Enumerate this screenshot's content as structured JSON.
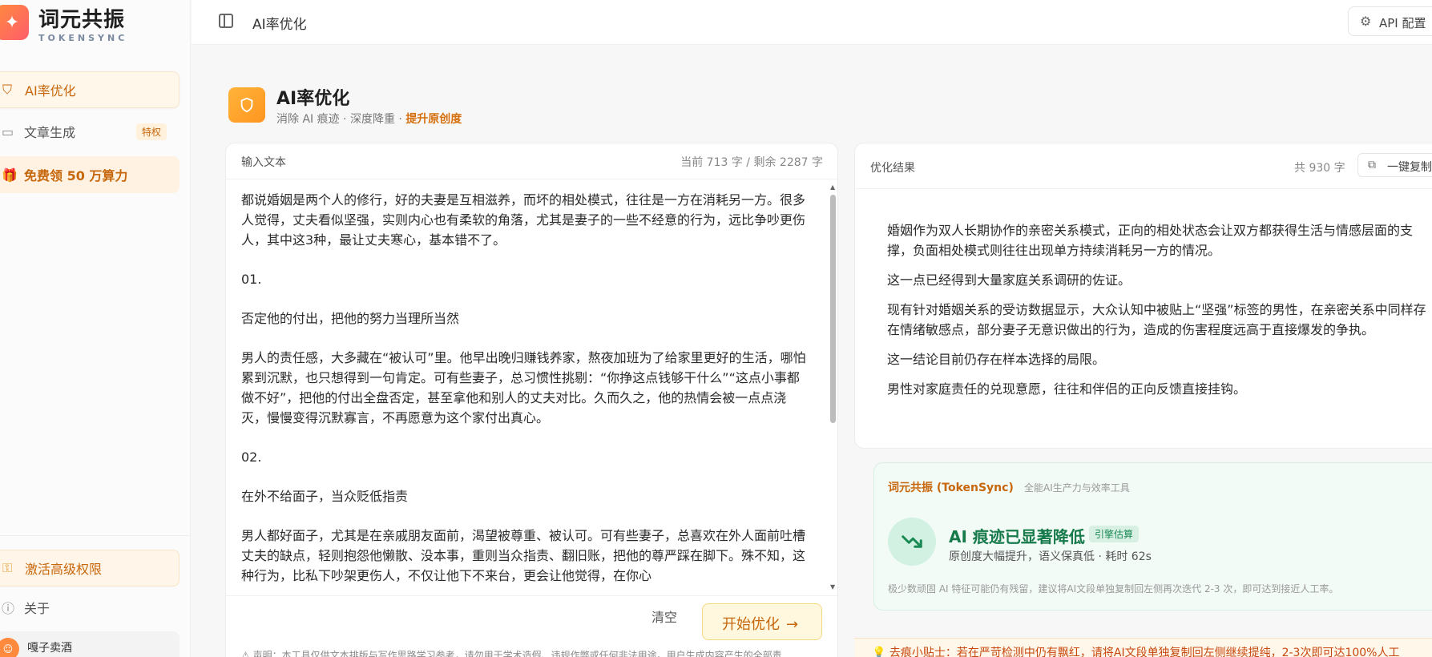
{
  "sidebar": {
    "brand": "词元共振",
    "brand_sub": "TOKENSYNC",
    "items": [
      {
        "label": "AI率优化"
      },
      {
        "label": "文章生成",
        "badge": "特权"
      },
      {
        "label": "免费领 50 万算力"
      }
    ],
    "activate_label": "激活高级权限",
    "about_label": "关于",
    "user_name": "嘎子卖酒"
  },
  "header": {
    "title": "AI率优化",
    "api_label": "API 配置"
  },
  "page": {
    "title": "AI率优化",
    "subtitle_plain": "消除 AI 痕迹 · 深度降重 · ",
    "subtitle_strong": "提升原创度"
  },
  "input": {
    "label": "输入文本",
    "count": "当前 713 字 / 剩余 2287 字",
    "paragraphs": [
      "都说婚姻是两个人的修行，好的夫妻是互相滋养，而坏的相处模式，往往是一方在消耗另一方。很多人觉得，丈夫看似坚强，实则内心也有柔软的角落，尤其是妻子的一些不经意的行为，远比争吵更伤人，其中这3种，最让丈夫寒心，基本错不了。",
      "01.",
      "否定他的付出，把他的努力当理所当然",
      "男人的责任感，大多藏在“被认可”里。他早出晚归赚钱养家，熬夜加班为了给家里更好的生活，哪怕累到沉默，也只想得到一句肯定。可有些妻子，总习惯性挑剔：“你挣这点钱够干什么”“这点小事都做不好”，把他的付出全盘否定，甚至拿他和别人的丈夫对比。久而久之，他的热情会被一点点浇灭，慢慢变得沉默寡言，不再愿意为这个家付出真心。",
      "02.",
      "在外不给面子，当众贬低指责",
      "男人都好面子，尤其是在亲戚朋友面前，渴望被尊重、被认可。可有些妻子，总喜欢在外人面前吐槽丈夫的缺点，轻则抱怨他懒散、没本事，重则当众指责、翻旧账，把他的尊严踩在脚下。殊不知，这种行为，比私下吵架更伤人，不仅让他下不来台，更会让他觉得，在你心"
    ],
    "clear_label": "清空",
    "start_label": "开始优化",
    "disclaimer": "声明：本工具仅供文本排版与写作思路学习参考，请勿用于学术造假、违规作弊或任何非法用途。用户生成内容产生的全部责"
  },
  "output": {
    "label": "优化结果",
    "count": "共 930 字",
    "copy_label": "一键复制",
    "paragraphs": [
      "婚姻作为双人长期协作的亲密关系模式，正向的相处状态会让双方都获得生活与情感层面的支撑，负面相处模式则往往出现单方持续消耗另一方的情况。",
      "这一点已经得到大量家庭关系调研的佐证。",
      "现有针对婚姻关系的受访数据显示，大众认知中被贴上“坚强”标签的男性，在亲密关系中同样存在情绪敏感点，部分妻子无意识做出的行为，造成的伤害程度远高于直接爆发的争执。",
      "这一结论目前仍存在样本选择的局限。",
      "男性对家庭责任的兑现意愿，往往和伴侣的正向反馈直接挂钩。"
    ]
  },
  "result": {
    "brand": "词元共振 (TokenSync)",
    "brand_sub": "全能AI生产力与效率工具",
    "title": "AI 痕迹已显著降低",
    "tag": "引擎估算",
    "subtitle": "原创度大幅提升，语义保真低 · 耗时 62s",
    "note": "极少数顽固 AI 特征可能仍有残留，建议将AI文段单独复制回左侧再次迭代 2-3 次，即可达到接近人工率。"
  },
  "tip": "去痕小贴士：若在严苛检测中仍有飘红，请将AI文段单独复制回左侧继续提纯，2-3次即可达100%人工",
  "icons": [
    "sparkle-logo-icon",
    "shield-icon",
    "document-icon",
    "gift-icon",
    "key-icon",
    "info-icon",
    "collapse-sidebar-icon",
    "gear-icon",
    "copy-icon",
    "arrow-right-icon",
    "trend-down-icon",
    "lightbulb-icon",
    "warning-icon"
  ]
}
